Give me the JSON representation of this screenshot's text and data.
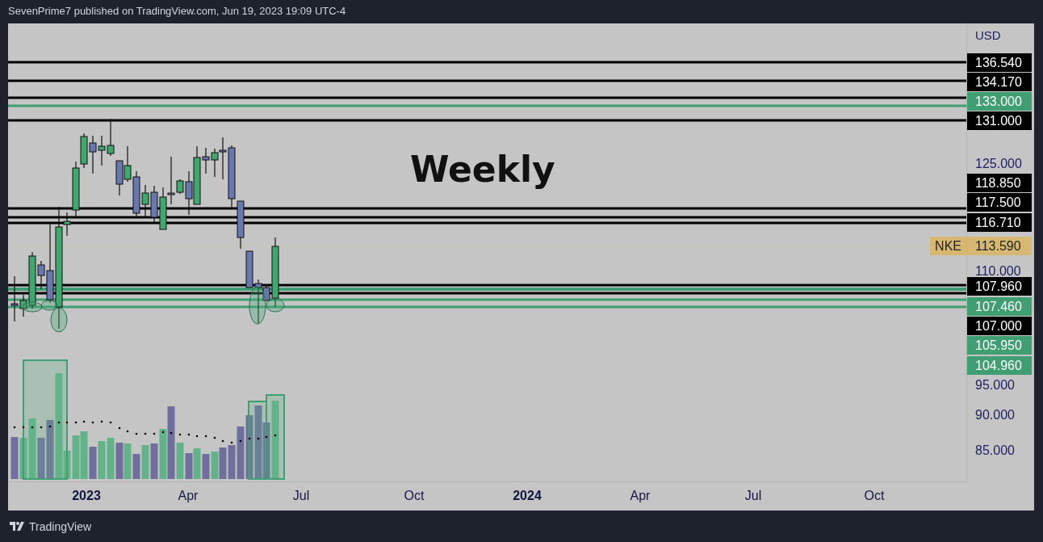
{
  "header": {
    "text": "SevenPrime7 published on TradingView.com, Jun 19, 2023 19:09 UTC-4"
  },
  "chart": {
    "title": "Weekly",
    "currency": "USD",
    "symbol_tag": "NKE",
    "price_axis": [
      {
        "label": "136.540",
        "kind": "marker",
        "color": "#000000"
      },
      {
        "label": "134.170",
        "kind": "marker",
        "color": "#000000"
      },
      {
        "label": "133.000",
        "kind": "marker",
        "color": "#3f9e72"
      },
      {
        "label": "131.000",
        "kind": "marker",
        "color": "#000000"
      },
      {
        "label": "125.000",
        "kind": "tick"
      },
      {
        "label": "118.850",
        "kind": "marker",
        "color": "#000000"
      },
      {
        "label": "117.500",
        "kind": "marker",
        "color": "#000000"
      },
      {
        "label": "116.710",
        "kind": "marker",
        "color": "#000000"
      },
      {
        "label": "113.590",
        "kind": "current",
        "color": "#d6b873"
      },
      {
        "label": "110.000",
        "kind": "tick"
      },
      {
        "label": "107.960",
        "kind": "marker",
        "color": "#000000"
      },
      {
        "label": "107.460",
        "kind": "marker",
        "color": "#3f9e72"
      },
      {
        "label": "107.000",
        "kind": "marker",
        "color": "#000000"
      },
      {
        "label": "105.950",
        "kind": "marker",
        "color": "#3f9e72"
      },
      {
        "label": "104.960",
        "kind": "marker",
        "color": "#3f9e72"
      },
      {
        "label": "95.000",
        "kind": "tick"
      },
      {
        "label": "90.000",
        "kind": "tick"
      },
      {
        "label": "85.000",
        "kind": "tick"
      }
    ],
    "time_axis": [
      {
        "label": "2023",
        "kind": "year"
      },
      {
        "label": "Apr",
        "kind": "month"
      },
      {
        "label": "Jul",
        "kind": "month"
      },
      {
        "label": "Oct",
        "kind": "month"
      },
      {
        "label": "2024",
        "kind": "year"
      },
      {
        "label": "Apr",
        "kind": "month"
      },
      {
        "label": "Jul",
        "kind": "month"
      },
      {
        "label": "Oct",
        "kind": "month"
      }
    ]
  },
  "footer": {
    "brand": "TradingView"
  }
}
